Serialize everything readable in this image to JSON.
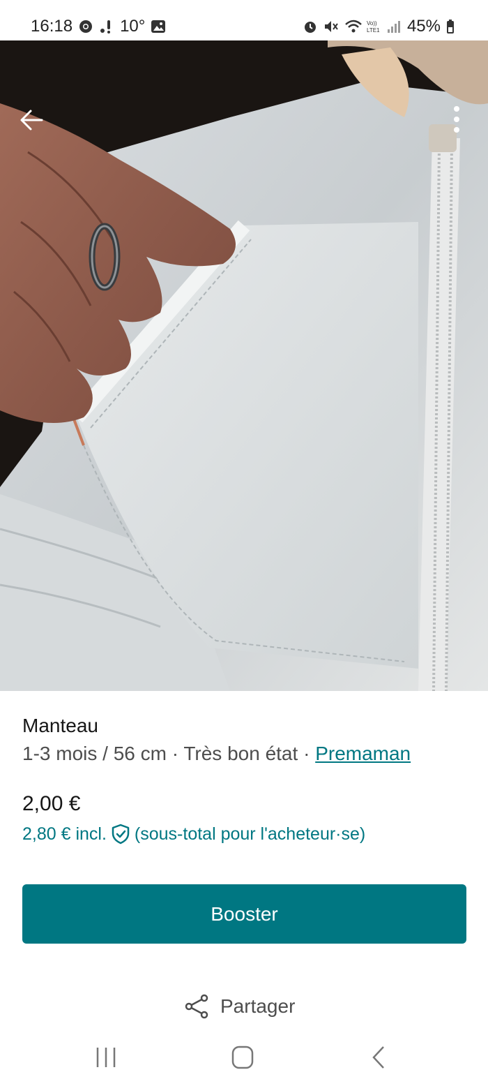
{
  "status_bar": {
    "time": "16:18",
    "temperature": "10°",
    "battery": "45%",
    "icons_left": [
      "chrome-icon",
      "notification-icon",
      "gallery-icon"
    ],
    "icons_right": [
      "alarm-icon",
      "mute-icon",
      "wifi-icon",
      "volte-icon",
      "signal-icon",
      "battery-icon"
    ]
  },
  "header": {
    "back_icon": "arrow-left-icon",
    "more_icon": "more-vertical-icon"
  },
  "gallery": {
    "image_count": 5,
    "active_index": 2
  },
  "item": {
    "title": "Manteau",
    "size": "1-3 mois / 56 cm",
    "separator": " · ",
    "condition": "Très bon état",
    "brand": "Premaman"
  },
  "pricing": {
    "price": "2,00 €",
    "price_incl": "2,80 € incl.",
    "price_incl_note": "(sous-total pour l'acheteur·se)"
  },
  "actions": {
    "boost_label": "Booster",
    "share_label": "Partager"
  },
  "colors": {
    "accent": "#007782",
    "text_primary": "#161616",
    "text_secondary": "#4d4d4d"
  }
}
